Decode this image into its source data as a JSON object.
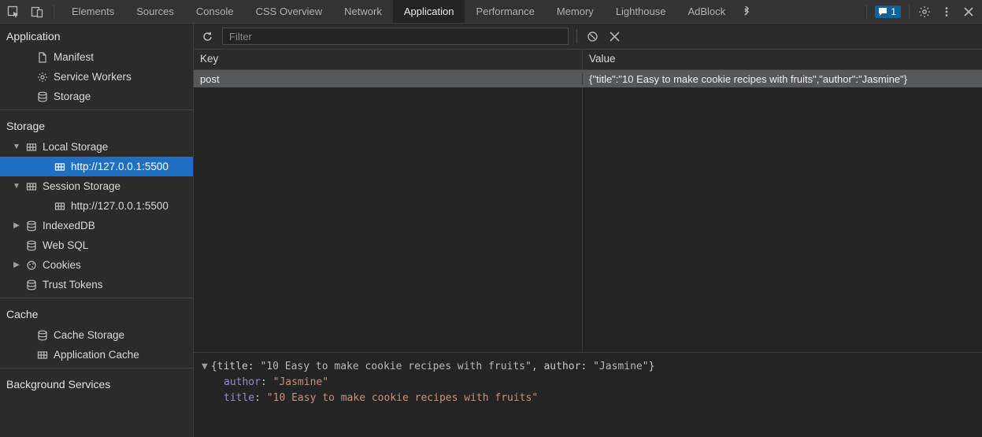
{
  "topbar": {
    "tabs": [
      {
        "label": "Elements",
        "active": false
      },
      {
        "label": "Sources",
        "active": false
      },
      {
        "label": "Console",
        "active": false
      },
      {
        "label": "CSS Overview",
        "active": false
      },
      {
        "label": "Network",
        "active": false
      },
      {
        "label": "Application",
        "active": true
      },
      {
        "label": "Performance",
        "active": false
      },
      {
        "label": "Memory",
        "active": false
      },
      {
        "label": "Lighthouse",
        "active": false
      },
      {
        "label": "AdBlock",
        "active": false
      }
    ],
    "messages_count": "1"
  },
  "sidebar": {
    "groups": [
      {
        "title": "Application",
        "items": [
          {
            "icon": "file-icon",
            "label": "Manifest",
            "interact": true
          },
          {
            "icon": "gear-icon",
            "label": "Service Workers",
            "interact": true
          },
          {
            "icon": "db-icon",
            "label": "Storage",
            "interact": true
          }
        ]
      },
      {
        "title": "Storage",
        "items": [
          {
            "icon": "grid-icon",
            "label": "Local Storage",
            "arrow": "down",
            "indent": 0,
            "interact": true
          },
          {
            "icon": "grid-icon",
            "label": "http://127.0.0.1:5500",
            "indent": 2,
            "selected": true,
            "interact": true
          },
          {
            "icon": "grid-icon",
            "label": "Session Storage",
            "arrow": "down",
            "indent": 0,
            "interact": true
          },
          {
            "icon": "grid-icon",
            "label": "http://127.0.0.1:5500",
            "indent": 2,
            "interact": true
          },
          {
            "icon": "db-icon",
            "label": "IndexedDB",
            "arrow": "right",
            "indent": 0,
            "interact": true
          },
          {
            "icon": "db-icon",
            "label": "Web SQL",
            "indent": 0,
            "interact": true
          },
          {
            "icon": "cookie-icon",
            "label": "Cookies",
            "arrow": "right",
            "indent": 0,
            "interact": true
          },
          {
            "icon": "db-icon",
            "label": "Trust Tokens",
            "indent": 0,
            "interact": true
          }
        ]
      },
      {
        "title": "Cache",
        "items": [
          {
            "icon": "db-icon",
            "label": "Cache Storage",
            "interact": true
          },
          {
            "icon": "grid-icon",
            "label": "Application Cache",
            "interact": true
          }
        ]
      },
      {
        "title": "Background Services",
        "items": []
      }
    ]
  },
  "toolbar": {
    "filter_placeholder": "Filter"
  },
  "kv_table": {
    "header_key": "Key",
    "header_value": "Value",
    "rows": [
      {
        "key": "post",
        "value": "{\"title\":\"10 Easy to make cookie recipes with fruits\",\"author\":\"Jasmine\"}",
        "selected": true
      }
    ]
  },
  "preview": {
    "summary_prefix": "{title: ",
    "summary_title": "\"10 Easy to make cookie recipes with fruits\"",
    "summary_mid": ", author: ",
    "summary_author": "\"Jasmine\"",
    "summary_suffix": "}",
    "author_key": "author",
    "author_val": "\"Jasmine\"",
    "title_key": "title",
    "title_val": "\"10 Easy to make cookie recipes with fruits\""
  }
}
